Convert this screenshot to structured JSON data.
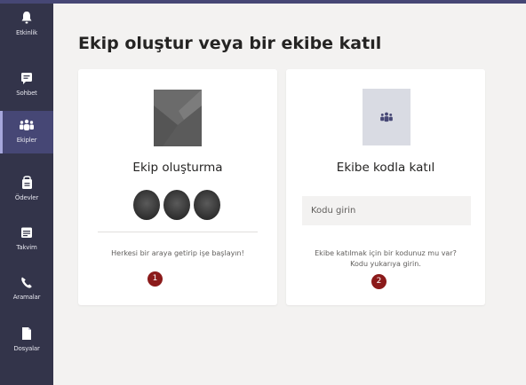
{
  "rail": {
    "items": [
      {
        "label": "Etkinlik",
        "icon": "bell-icon"
      },
      {
        "label": "Sohbet",
        "icon": "chat-icon"
      },
      {
        "label": "Ekipler",
        "icon": "teams-icon",
        "active": true
      },
      {
        "label": "Ödevler",
        "icon": "assignments-icon"
      },
      {
        "label": "Takvim",
        "icon": "calendar-icon"
      },
      {
        "label": "Aramalar",
        "icon": "phone-icon"
      },
      {
        "label": "Dosyalar",
        "icon": "files-icon"
      }
    ]
  },
  "main": {
    "title": "Ekip oluştur veya bir ekibe katıl",
    "create_card": {
      "title": "Ekip oluşturma",
      "description": "Herkesi bir araya getirip işe başlayın!",
      "step": "1"
    },
    "join_card": {
      "title": "Ekibe kodla katıl",
      "input_placeholder": "Kodu girin",
      "description_line1": "Ekibe katılmak için bir kodunuz mu var?",
      "description_line2": "Kodu yukarıya girin.",
      "step": "2"
    }
  },
  "colors": {
    "rail_bg": "#33344a",
    "rail_active": "#464775",
    "step_badge": "#8b1a1a"
  }
}
